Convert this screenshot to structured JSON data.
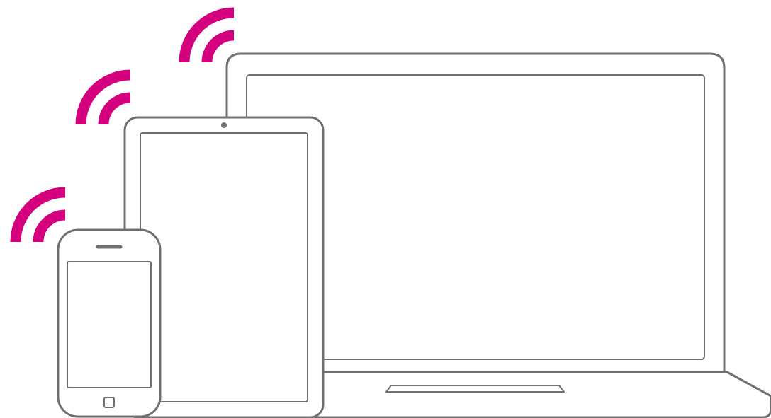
{
  "devices": [
    {
      "name": "laptop",
      "icon": "laptop-icon"
    },
    {
      "name": "tablet",
      "icon": "tablet-icon"
    },
    {
      "name": "smartphone",
      "icon": "smartphone-icon"
    }
  ],
  "signals": [
    {
      "device": "laptop",
      "icon": "wifi-signal-icon",
      "arcs": 2
    },
    {
      "device": "tablet",
      "icon": "wifi-signal-icon",
      "arcs": 2
    },
    {
      "device": "smartphone",
      "icon": "wifi-signal-icon",
      "arcs": 2
    }
  ],
  "colors": {
    "signal": "#d4007e",
    "outline": "#707070",
    "background": "#ffffff"
  }
}
